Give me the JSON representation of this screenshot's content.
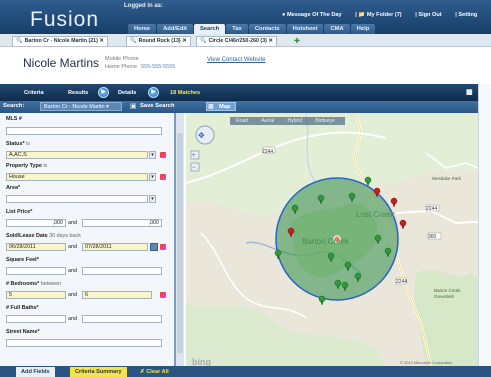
{
  "app": {
    "logo": "Fusion",
    "logged_in": "Logged in as:"
  },
  "top_links": [
    "Message Of The Day",
    "My Folder (7)",
    "Sign Out",
    "Setting"
  ],
  "nav_tabs": [
    {
      "label": "Home"
    },
    {
      "label": "Add/Edit"
    },
    {
      "label": "Search",
      "active": true
    },
    {
      "label": "Tax"
    },
    {
      "label": "Contacts"
    },
    {
      "label": "Hotsheet"
    },
    {
      "label": "CMA"
    },
    {
      "label": "Help"
    }
  ],
  "search_tabs": [
    {
      "label": "Barton Cr - Nicole Martin (21)"
    },
    {
      "label": "Round Rock (13)"
    },
    {
      "label": "Circle C/46r/250-260 (3)"
    }
  ],
  "contact": {
    "name": "Nicole Martins",
    "mobile_label": "Mobile Phone",
    "home_label": "Home Phone",
    "home_value": "555-555-5555",
    "view_link": "View Contact Website"
  },
  "subbar": {
    "criteria": "Criteria",
    "results": "Results",
    "details": "Details",
    "matches": "18 Matches"
  },
  "searchbar": {
    "label": "Search:",
    "selected": "Barton Cr - Nicole Martin",
    "save": "Save Search",
    "map": "Map"
  },
  "criteria": {
    "mls_label": "MLS #",
    "status_label": "Status*",
    "status_in": "is",
    "status_value": "A,AC,S",
    "ptype_label": "Property Type",
    "ptype_in": "is",
    "ptype_value": "House",
    "area_label": "Area*",
    "list_price_label": "List Price*",
    "and": "and",
    "price_to": ",000",
    "price_to2": ",000",
    "sold_label": "Sold/Lease Date",
    "sold_hint": "30 days back",
    "sold_from": "06/28/2011",
    "sold_to": "07/28/2011",
    "sqft_label": "Square Feet*",
    "bed_label": "# Bedrooms*",
    "bed_hint": "between",
    "bed_from": "5",
    "bed_to": "6",
    "bath_label": "# Full Baths*",
    "street_label": "Street Name*"
  },
  "bottom_tabs": [
    "Add Fields",
    "Criteria Summary",
    "Clear All"
  ],
  "map": {
    "tools": [
      "Road",
      "Aerial",
      "Hybrid",
      "Birdseye"
    ],
    "labels": {
      "lost_creek": "Lost Creek",
      "barton_creek": "Barton Creek",
      "road_2244": "2244",
      "road_2244b": "2244",
      "road_360": "360",
      "road_2244c": "2244",
      "bull_creek": "Barton Creek Greenbelt",
      "west_lake": "Westlake Park",
      "bing": "bing",
      "copyright": "© 2010 Microsoft Corporation"
    },
    "accent": "#3f9b54"
  },
  "colors": {
    "brand_dark": "#143a63",
    "accent_green": "#2c8a3a",
    "pin_red": "#c41f1f",
    "pin_green": "#2e9a3a",
    "circle": "#2565c7"
  }
}
